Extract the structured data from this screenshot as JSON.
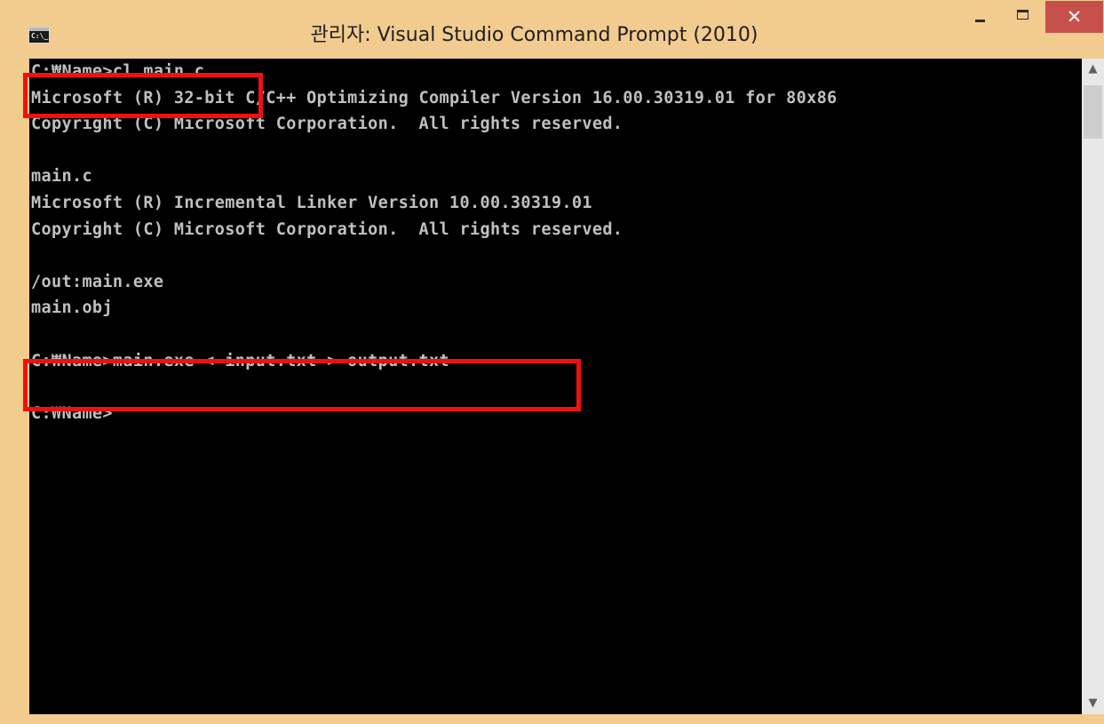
{
  "window": {
    "title": "관리자: Visual Studio Command Prompt (2010)",
    "icon_label": "C:\\_",
    "icon": "cmd-console-icon",
    "buttons": {
      "minimize": "minimize-icon",
      "maximize": "maximize-icon",
      "close_label": "✕"
    },
    "frame_color": "#f2cb8e",
    "close_color": "#c7504b"
  },
  "console": {
    "background": "#000000",
    "text_color": "#c0c0c0",
    "lines": [
      "C:₩Name>cl main.c",
      "Microsoft (R) 32-bit C/C++ Optimizing Compiler Version 16.00.30319.01 for 80x86",
      "Copyright (C) Microsoft Corporation.  All rights reserved.",
      "",
      "main.c",
      "Microsoft (R) Incremental Linker Version 10.00.30319.01",
      "Copyright (C) Microsoft Corporation.  All rights reserved.",
      "",
      "/out:main.exe",
      "main.obj",
      "",
      "C:₩Name>main.exe < input.txt > output.txt",
      "",
      "C:₩Name>"
    ]
  },
  "highlight_color": "#ee1111",
  "scrollbar": {
    "up": "▲",
    "down": "▼"
  }
}
